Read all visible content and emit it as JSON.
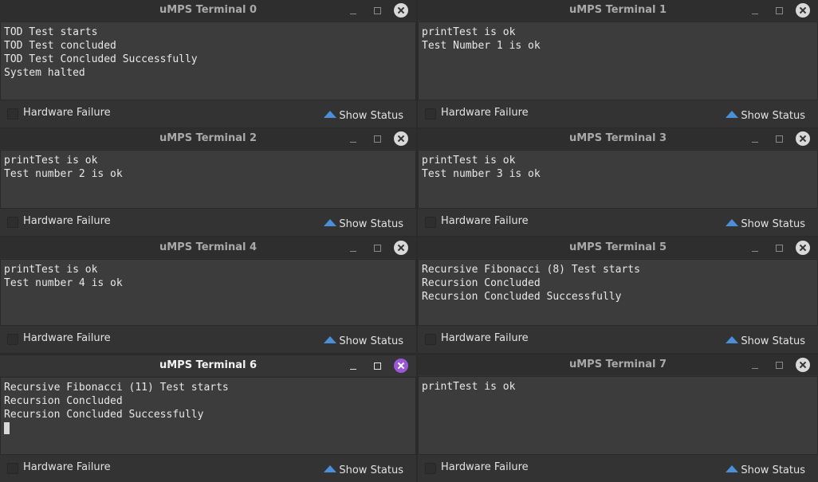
{
  "hardware_failure_label": "Hardware Failure",
  "show_status_label": "Show Status",
  "colors": {
    "active_close": "#9a57d8",
    "status_arrow": "#4a8fd8",
    "terminal_bg": "#3c3c3c"
  },
  "terminals": [
    {
      "title": "uMPS Terminal 0",
      "lines": [
        "TOD Test starts",
        "TOD Test concluded",
        "TOD Test Concluded Successfully",
        "System halted"
      ]
    },
    {
      "title": "uMPS Terminal 1",
      "lines": [
        "printTest is ok",
        "Test Number 1 is ok"
      ]
    },
    {
      "title": "uMPS Terminal 2",
      "lines": [
        "printTest is ok",
        "Test number 2 is ok"
      ]
    },
    {
      "title": "uMPS Terminal 3",
      "lines": [
        "printTest is ok",
        "Test number 3 is ok"
      ]
    },
    {
      "title": "uMPS Terminal 4",
      "lines": [
        "printTest is ok",
        "Test number 4 is ok"
      ]
    },
    {
      "title": "uMPS Terminal 5",
      "lines": [
        "Recursive Fibonacci (8) Test starts",
        "Recursion Concluded",
        "Recursion Concluded Successfully"
      ]
    },
    {
      "title": "uMPS Terminal 6",
      "lines": [
        "Recursive Fibonacci (11) Test starts",
        "Recursion Concluded",
        "Recursion Concluded Successfully"
      ]
    },
    {
      "title": "uMPS Terminal 7",
      "lines": [
        "printTest is ok"
      ]
    }
  ]
}
